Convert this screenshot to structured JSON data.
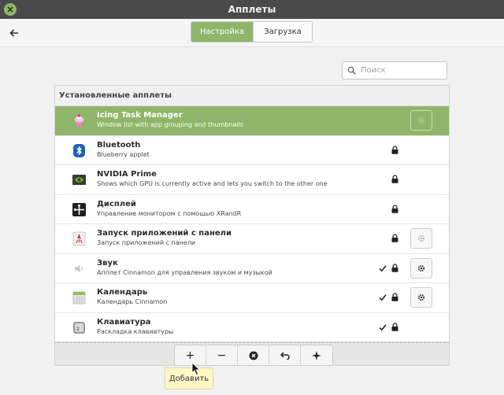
{
  "window": {
    "title": "Апплеты"
  },
  "tabs": [
    {
      "label": "Настройка",
      "active": true
    },
    {
      "label": "Загрузка",
      "active": false
    }
  ],
  "search": {
    "placeholder": "Поиск",
    "value": ""
  },
  "panel": {
    "header": "Установленные апплеты"
  },
  "applets": [
    {
      "name": "Icing Task Manager",
      "desc": "Window list with app grouping and thumbnails",
      "icon": "cupcake-icon",
      "selected": true,
      "checked": false,
      "locked": false,
      "config": "disabled"
    },
    {
      "name": "Bluetooth",
      "desc": "Blueberry applet",
      "icon": "bluetooth-icon",
      "selected": false,
      "checked": false,
      "locked": true,
      "config": "none"
    },
    {
      "name": "NVIDIA Prime",
      "desc": "Shows which GPU is currently active and lets you switch to the other one",
      "icon": "nvidia-icon",
      "selected": false,
      "checked": false,
      "locked": true,
      "config": "none"
    },
    {
      "name": "Дисплей",
      "desc": "Управление монитором с помощью XRandR",
      "icon": "display-icon",
      "selected": false,
      "checked": false,
      "locked": true,
      "config": "none"
    },
    {
      "name": "Запуск приложений с панели",
      "desc": "Запуск приложений с панели",
      "icon": "launcher-icon",
      "selected": false,
      "checked": false,
      "locked": true,
      "config": "disabled"
    },
    {
      "name": "Звук",
      "desc": "Апплет Cinnamon для управления звуком и музыкой",
      "icon": "speaker-icon",
      "selected": false,
      "checked": true,
      "locked": true,
      "config": "enabled"
    },
    {
      "name": "Календарь",
      "desc": "Календарь Cinnamon",
      "icon": "calendar-icon",
      "selected": false,
      "checked": true,
      "locked": true,
      "config": "enabled"
    },
    {
      "name": "Клавиатура",
      "desc": "Раскладка клавиатуры",
      "icon": "keyboard-icon",
      "selected": false,
      "checked": true,
      "locked": true,
      "config": "none"
    }
  ],
  "toolbar": {
    "add": "+",
    "remove": "−",
    "tooltip": "Добавить"
  },
  "colors": {
    "accent": "#8fb56a",
    "titlebar": "#4a4a4a",
    "tooltip": "#fff8c6"
  }
}
